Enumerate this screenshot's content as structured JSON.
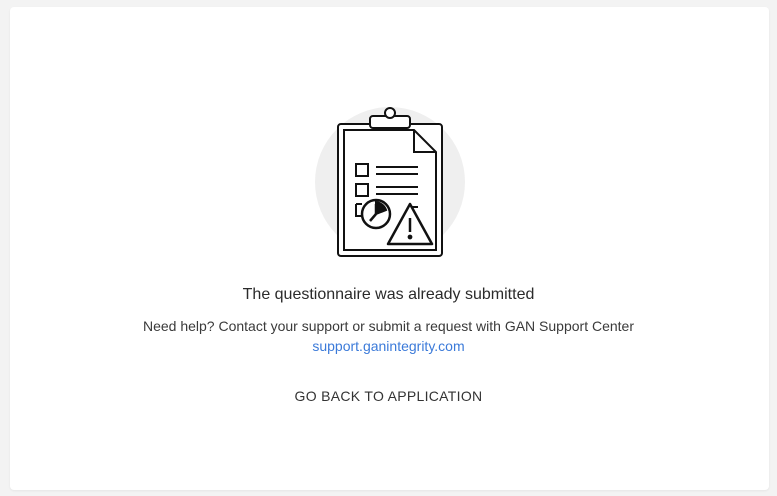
{
  "message": {
    "title": "The questionnaire was already submitted",
    "help_text": "Need help? Contact your support or submit a request with GAN Support Center",
    "support_link": "support.ganintegrity.com"
  },
  "actions": {
    "back_label": "GO BACK TO APPLICATION"
  },
  "illustration": {
    "icon": "clipboard-warning-icon",
    "circle_color": "#efefef",
    "stroke_color": "#111111"
  },
  "colors": {
    "link": "#3b7ad9",
    "background": "#f3f3f3",
    "card": "#ffffff"
  }
}
